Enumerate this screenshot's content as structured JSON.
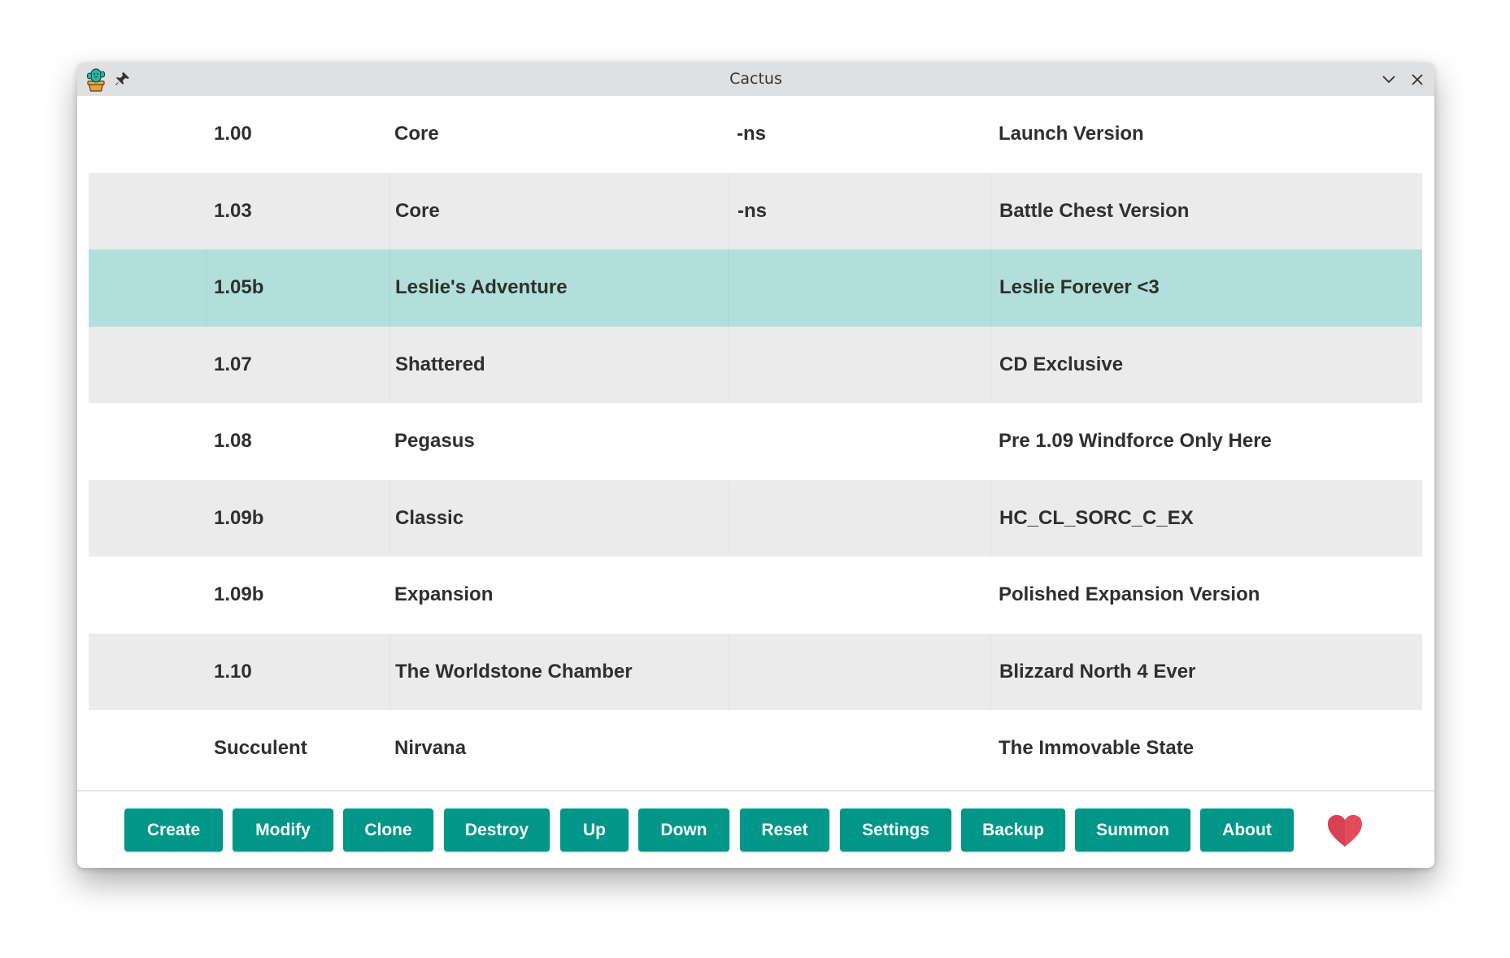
{
  "window": {
    "title": "Cactus"
  },
  "colors": {
    "accent": "#009688",
    "selected_row": "#b2dfdb",
    "alt_row": "#ebebeb",
    "heart": "#e34a5c"
  },
  "icons": {
    "app": "cactus-icon",
    "pin": "pin-icon",
    "minimize": "chevron-down-icon",
    "close": "close-icon",
    "heart": "heart-icon"
  },
  "table": {
    "selected_index": 2,
    "rows": [
      {
        "version": "1.00",
        "name": "Core",
        "flags": "-ns",
        "description": "Launch Version"
      },
      {
        "version": "1.03",
        "name": "Core",
        "flags": "-ns",
        "description": "Battle Chest Version"
      },
      {
        "version": "1.05b",
        "name": "Leslie's Adventure",
        "flags": "",
        "description": "Leslie Forever <3"
      },
      {
        "version": "1.07",
        "name": "Shattered",
        "flags": "",
        "description": "CD Exclusive"
      },
      {
        "version": "1.08",
        "name": "Pegasus",
        "flags": "",
        "description": "Pre 1.09 Windforce Only Here"
      },
      {
        "version": "1.09b",
        "name": "Classic",
        "flags": "",
        "description": "HC_CL_SORC_C_EX"
      },
      {
        "version": "1.09b",
        "name": "Expansion",
        "flags": "",
        "description": "Polished Expansion Version"
      },
      {
        "version": "1.10",
        "name": "The Worldstone Chamber",
        "flags": "",
        "description": "Blizzard North 4 Ever"
      },
      {
        "version": "Succulent",
        "name": "Nirvana",
        "flags": "",
        "description": "The Immovable State"
      }
    ]
  },
  "toolbar": {
    "create": "Create",
    "modify": "Modify",
    "clone": "Clone",
    "destroy": "Destroy",
    "up": "Up",
    "down": "Down",
    "reset": "Reset",
    "settings": "Settings",
    "backup": "Backup",
    "summon": "Summon",
    "about": "About"
  }
}
